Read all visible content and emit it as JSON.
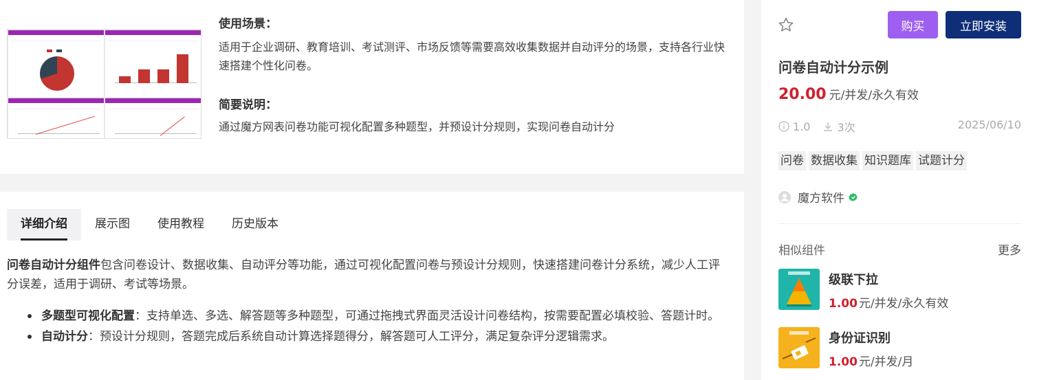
{
  "usage": {
    "title": "使用场景：",
    "text": "适用于企业调研、教育培训、考试测评、市场反馈等需要高效收集数据并自动评分的场景，支持各行业快速搭建个性化问卷。"
  },
  "brief": {
    "title": "简要说明：",
    "text": "通过魔方网表问卷功能可视化配置多种题型，并预设计分规则，实现问卷自动计分"
  },
  "tabs": [
    {
      "label": "详细介绍",
      "active": true
    },
    {
      "label": "展示图"
    },
    {
      "label": "使用教程"
    },
    {
      "label": "历史版本"
    }
  ],
  "intro": {
    "bold": "问卷自动计分组件",
    "text": "包含问卷设计、数据收集、自动评分等功能，通过可视化配置问卷与预设计分规则，快速搭建问卷计分系统，减少人工评分误差，适用于调研、考试等场景。"
  },
  "features": [
    {
      "bold": "多题型可视化配置",
      "text": "：支持单选、多选、解答题等多种题型，可通过拖拽式界面灵活设计问卷结构，按需要配置必填校验、答题计时。"
    },
    {
      "bold": "自动计分",
      "text": "：预设计分规则，答题完成后系统自动计算选择题得分，解答题可人工评分，满足复杂评分逻辑需求。"
    }
  ],
  "product": {
    "buy_label": "购买",
    "install_label": "立即安装",
    "title": "问卷自动计分示例",
    "price": "20.00",
    "price_unit": "元/并发/永久有效",
    "version": "1.0",
    "downloads": "3次",
    "date": "2025/06/10",
    "tags": [
      "问卷",
      "数据收集",
      "知识题库",
      "试题计分"
    ],
    "author": "魔方软件"
  },
  "similar": {
    "title": "相似组件",
    "more": "更多",
    "items": [
      {
        "name": "级联下拉",
        "price": "1.00",
        "unit": "元/并发/永久有效"
      },
      {
        "name": "身份证识别",
        "price": "1.00",
        "unit": "元/并发/月"
      }
    ]
  },
  "colors": {
    "buy": "#9e5ff0",
    "install": "#0f2e78",
    "price": "#d0202e",
    "thumb_header": "#9b27b0"
  }
}
